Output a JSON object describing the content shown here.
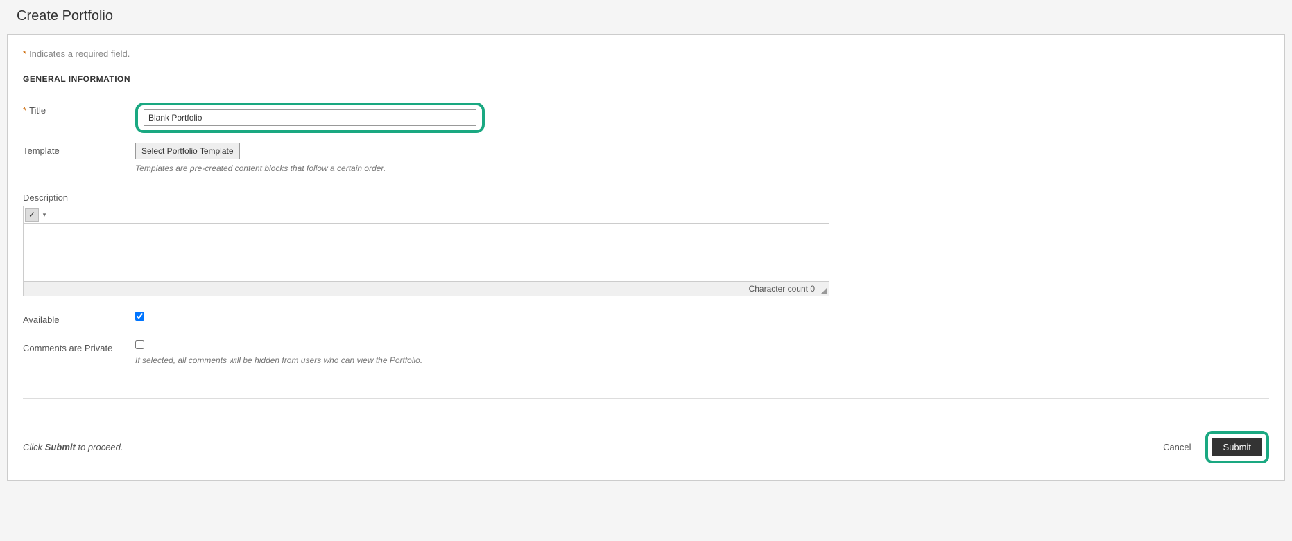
{
  "page": {
    "title": "Create Portfolio",
    "required_note": "Indicates a required field."
  },
  "section": {
    "general": "GENERAL INFORMATION"
  },
  "fields": {
    "title": {
      "label": "Title",
      "value": "Blank Portfolio"
    },
    "template": {
      "label": "Template",
      "button": "Select Portfolio Template",
      "help": "Templates are pre-created content blocks that follow a certain order."
    },
    "description": {
      "label": "Description",
      "char_count_label": "Character count",
      "char_count": "0"
    },
    "available": {
      "label": "Available",
      "checked": true
    },
    "comments_private": {
      "label": "Comments are Private",
      "checked": false,
      "help": "If selected, all comments will be hidden from users who can view the Portfolio."
    }
  },
  "footer": {
    "proceed_pre": "Click ",
    "proceed_bold": "Submit",
    "proceed_post": " to proceed.",
    "cancel": "Cancel",
    "submit": "Submit"
  }
}
